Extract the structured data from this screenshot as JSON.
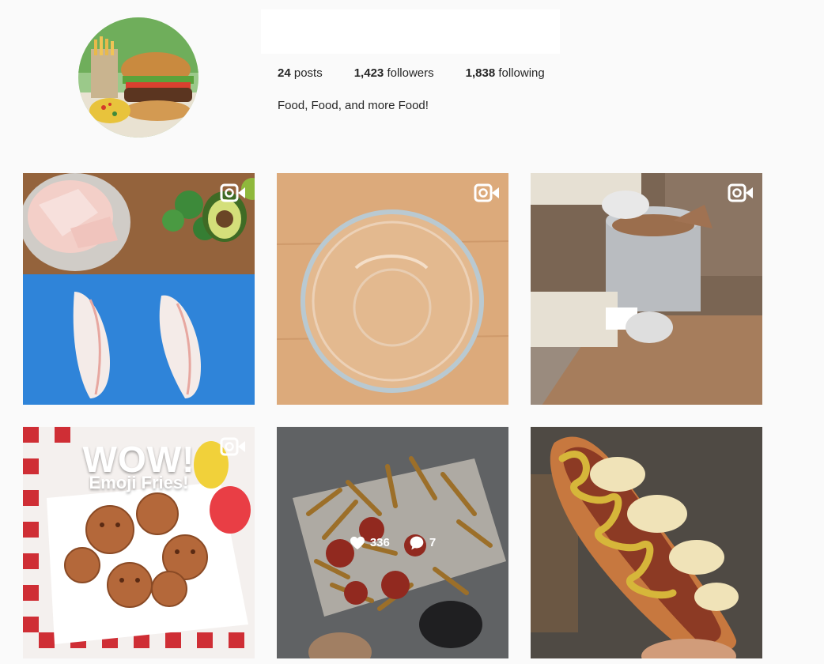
{
  "profile": {
    "username": "",
    "avatar_alt": "burger-and-fries-avatar",
    "stats": {
      "posts_count": "24",
      "posts_label": "posts",
      "followers_count": "1,423",
      "followers_label": "followers",
      "following_count": "1,838",
      "following_label": "following"
    },
    "bio": "Food, Food, and more Food!"
  },
  "posts": [
    {
      "subject": "raw fish fillets with avocado and cilantro",
      "type": "video"
    },
    {
      "subject": "empty glass bowl on wooden board",
      "type": "video"
    },
    {
      "subject": "chocolate being poured into a steel pot",
      "type": "video"
    },
    {
      "subject": "emoji fries in a basket",
      "type": "video",
      "headline": "WOW!",
      "subheadline": "Emoji Fries!"
    },
    {
      "subject": "loaded fries with pepperoni",
      "type": "image",
      "likes": "336",
      "comments": "7"
    },
    {
      "subject": "sausage hot dog with sauerkraut and mustard",
      "type": "image"
    }
  ],
  "icons": {
    "video": "video-camera-icon",
    "like": "heart-icon",
    "comment": "comment-bubble-icon"
  },
  "colors": {
    "background": "#fafafa",
    "text": "#262626"
  }
}
